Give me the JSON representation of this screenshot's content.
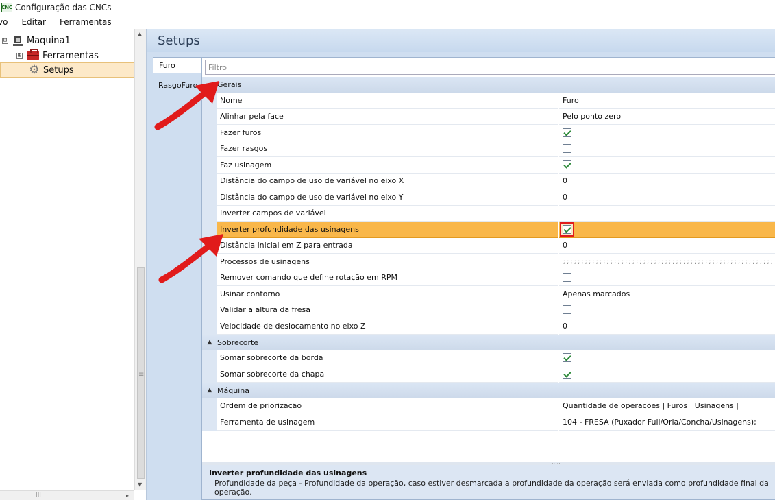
{
  "window": {
    "title": "Configuração das CNCs",
    "app_icon_label": "CNC"
  },
  "menu": {
    "items": [
      "vo",
      "Editar",
      "Ferramentas"
    ]
  },
  "tree": {
    "root": {
      "label": "Maquina1",
      "expander": "⊟"
    },
    "items": [
      {
        "label": "Ferramentas",
        "expander": "⊞",
        "icon": "toolbox-icon"
      },
      {
        "label": "Setups",
        "icon": "gear-icon",
        "selected": true
      }
    ]
  },
  "main": {
    "header": "Setups",
    "tabs": [
      {
        "label": "Furo",
        "active": true
      },
      {
        "label": "RasgoFuro",
        "active": false
      }
    ],
    "filter_placeholder": "Filtro"
  },
  "property_grid": {
    "categories": [
      {
        "label": "Gerais",
        "rows": [
          {
            "name": "Nome",
            "value": "Furo"
          },
          {
            "name": "Alinhar pela face",
            "value": "Pelo ponto zero"
          },
          {
            "name": "Fazer furos",
            "checkbox": true
          },
          {
            "name": "Fazer rasgos",
            "checkbox": false
          },
          {
            "name": "Faz usinagem",
            "checkbox": true
          },
          {
            "name": "Distância do campo de uso de variável no eixo X",
            "value": "0"
          },
          {
            "name": "Distância do campo de uso de variável no eixo Y",
            "value": "0"
          },
          {
            "name": "Inverter campos de variável",
            "checkbox": false
          },
          {
            "name": "Inverter profundidade das usinagens",
            "checkbox": true,
            "selected": true
          },
          {
            "name": "Distância inicial em Z para entrada",
            "value": "0"
          },
          {
            "name": "Processos de usinagens",
            "value": ";;;;;;;;;;;;;;;;;;;;;;;;;;;;;;;;;;;;;;;;;;;;;;;;;;;;;;;;;;;;;"
          },
          {
            "name": "Remover comando que define rotação em RPM",
            "checkbox": false
          },
          {
            "name": "Usinar contorno",
            "value": "Apenas marcados"
          },
          {
            "name": "Validar a altura da fresa",
            "checkbox": false
          },
          {
            "name": "Velocidade de deslocamento no eixo Z",
            "value": "0"
          }
        ]
      },
      {
        "label": "Sobrecorte",
        "rows": [
          {
            "name": "Somar sobrecorte da borda",
            "checkbox": true
          },
          {
            "name": "Somar sobrecorte da chapa",
            "checkbox": true
          }
        ]
      },
      {
        "label": "Máquina",
        "rows": [
          {
            "name": "Ordem de priorização",
            "value": "Quantidade de operações | Furos | Usinagens |"
          },
          {
            "name": "Ferramenta de usinagem",
            "value": "104 - FRESA (Puxador Full/Orla/Concha/Usinagens);"
          }
        ]
      }
    ]
  },
  "description": {
    "title": "Inverter profundidade das usinagens",
    "text": "Profundidade da peça - Profundidade da operação, caso estiver desmarcada a profundidade da operação será enviada como profundidade final da operação."
  },
  "colors": {
    "selection": "#f9b74a",
    "annotation": "#e11b1b",
    "check": "#2e8b3a",
    "category_bg": "#dbe6f4"
  }
}
